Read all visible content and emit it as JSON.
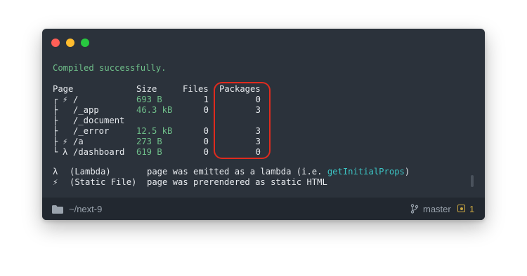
{
  "window": {
    "traffic_lights": [
      "close",
      "minimize",
      "maximize"
    ]
  },
  "terminal": {
    "compiled_message": "Compiled successfully.",
    "headers": {
      "page": "Page",
      "size": "Size",
      "files": "Files",
      "packages": "Packages"
    },
    "rows": [
      {
        "tree": "┌",
        "type": "⚡",
        "page": "/",
        "size": "693 B",
        "files": "1",
        "packages": "0"
      },
      {
        "tree": "├",
        "type": "",
        "page": "/_app",
        "size": "46.3 kB",
        "files": "0",
        "packages": "3"
      },
      {
        "tree": "├",
        "type": "",
        "page": "/_document",
        "size": "",
        "files": "",
        "packages": ""
      },
      {
        "tree": "├",
        "type": "",
        "page": "/_error",
        "size": "12.5 kB",
        "files": "0",
        "packages": "3"
      },
      {
        "tree": "├",
        "type": "⚡",
        "page": "/a",
        "size": "273 B",
        "files": "0",
        "packages": "3"
      },
      {
        "tree": "└",
        "type": "λ",
        "page": "/dashboard",
        "size": "619 B",
        "files": "0",
        "packages": "0"
      }
    ],
    "legend": [
      {
        "symbol": "λ",
        "label": "(Lambda)",
        "desc_prefix": "page was emitted as a lambda (i.e. ",
        "desc_highlight": "getInitialProps",
        "desc_suffix": ")"
      },
      {
        "symbol": "⚡",
        "label": "(Static File)",
        "desc_prefix": "page was prerendered as static HTML",
        "desc_highlight": "",
        "desc_suffix": ""
      }
    ]
  },
  "statusbar": {
    "path": "~/next-9",
    "branch": "master",
    "badge_count": "1"
  },
  "colors": {
    "background": "#2b323b",
    "success": "#6fbf8a",
    "highlight_box": "#e02b1e",
    "accent_cyan": "#3cc4c4"
  }
}
